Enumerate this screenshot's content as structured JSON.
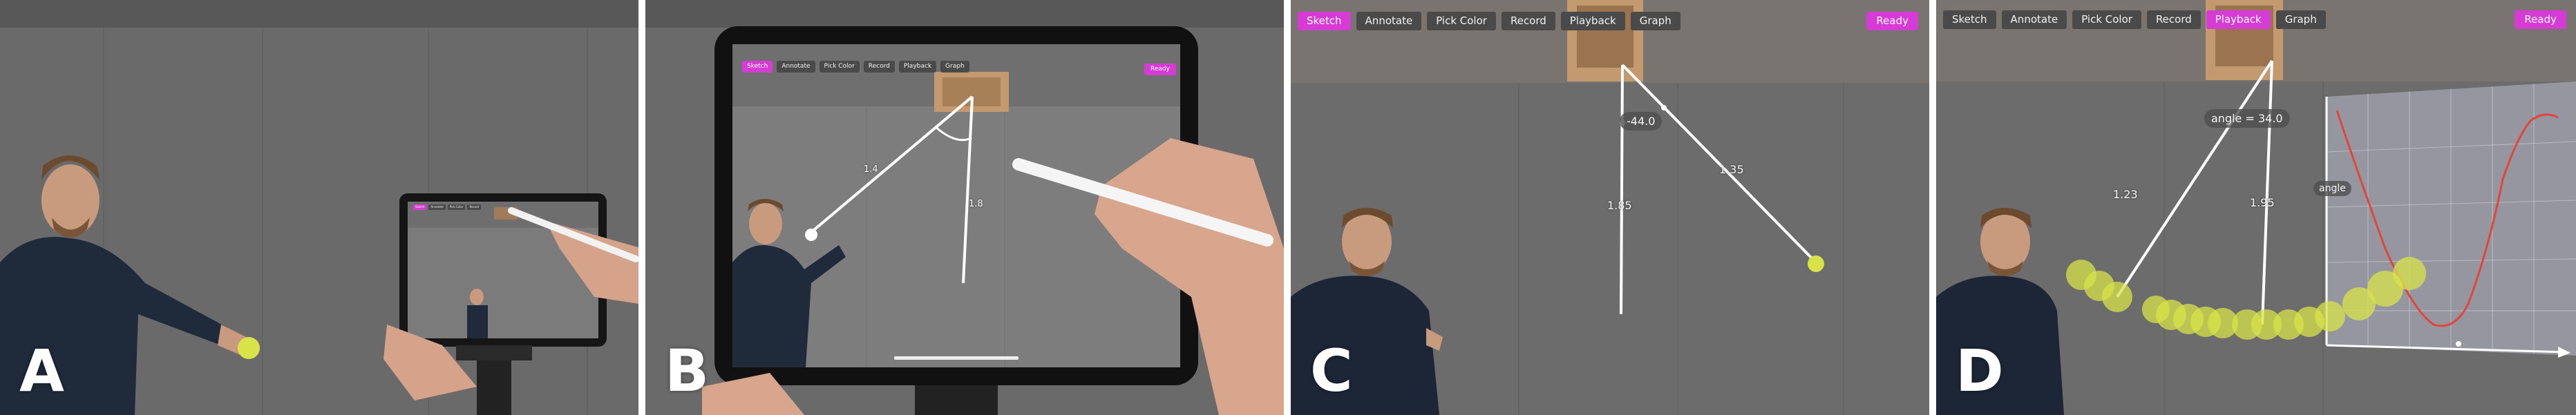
{
  "panels": {
    "a": {
      "letter": "A"
    },
    "b": {
      "letter": "B"
    },
    "c": {
      "letter": "C"
    },
    "d": {
      "letter": "D"
    }
  },
  "toolbar": {
    "sketch": "Sketch",
    "annotate": "Annotate",
    "pick_color": "Pick Color",
    "record": "Record",
    "playback": "Playback",
    "graph": "Graph",
    "ready": "Ready"
  },
  "annotations": {
    "c_angle": "-44.0",
    "c_length_vertical": "1.85",
    "c_length_string": "1.35",
    "d_angle": "angle = 34.0",
    "d_length_string": "1.23",
    "d_length_vertical": "1.95",
    "d_graph_label": "angle",
    "b_length_string": "1.4",
    "b_length_vertical": "1.8"
  },
  "colors": {
    "accent": "#d63bd6",
    "button_bg": "#4a4a4a",
    "ball": "#d8e34a",
    "graph_line": "#e2453a",
    "wall": "#5e5e5e"
  }
}
